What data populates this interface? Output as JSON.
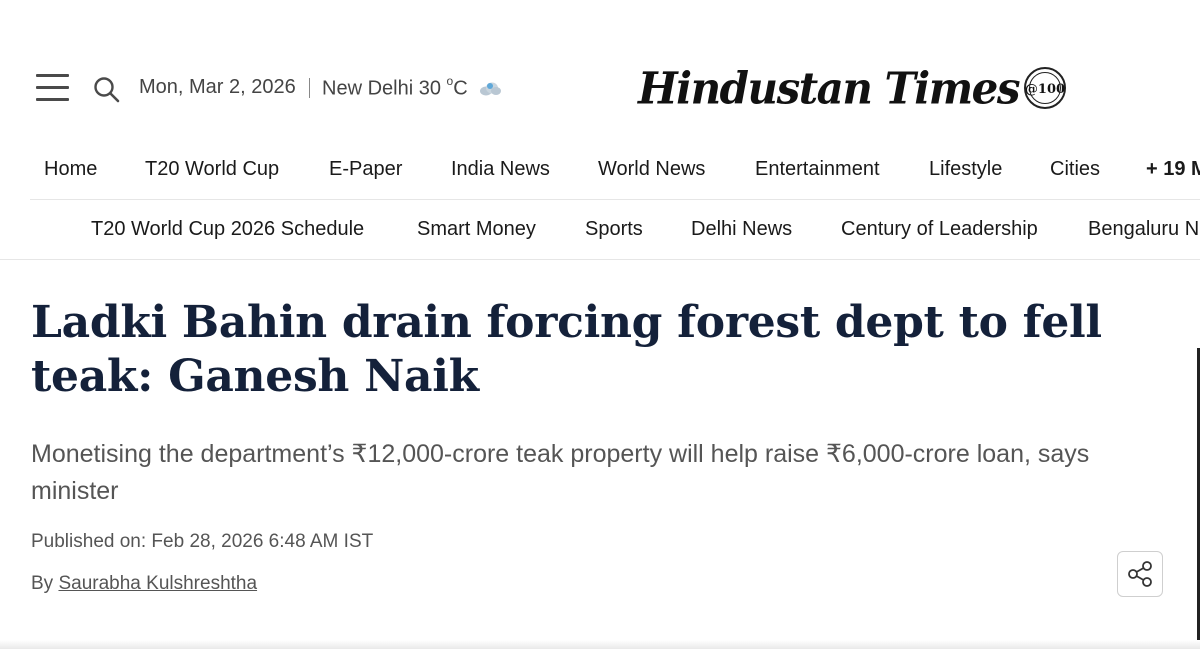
{
  "header": {
    "date": "Mon, Mar 2, 2026",
    "weather_city_temp": "New Delhi 30",
    "weather_unit_deg": "o",
    "weather_unit": "C",
    "logo_text": "Hindustan Times",
    "logo_badge": "@100",
    "icons": [
      "hamburger-menu-icon",
      "search-icon",
      "cloud-icon",
      "share-icon"
    ]
  },
  "nav_primary": [
    "Home",
    "T20 World Cup",
    "E-Paper",
    "India News",
    "World News",
    "Entertainment",
    "Lifestyle",
    "Cities",
    "+ 19 M"
  ],
  "nav_secondary": [
    "T20 World Cup 2026 Schedule",
    "Smart Money",
    "Sports",
    "Delhi News",
    "Century of Leadership",
    "Bengaluru N"
  ],
  "article": {
    "headline": "Ladki Bahin drain forcing forest dept to fell teak: Ganesh Naik",
    "subhead": "Monetising the department’s ₹12,000-crore teak property will help raise ₹6,000-crore loan, says minister",
    "published": "Published on: Feb 28, 2026 6:48 AM IST",
    "byline_prefix": "By",
    "author": "Saurabha Kulshreshtha"
  },
  "colors": {
    "headline": "#14213a",
    "text_muted": "#555555",
    "nav_text": "#1a1a1a",
    "divider": "#e6e6e6"
  }
}
